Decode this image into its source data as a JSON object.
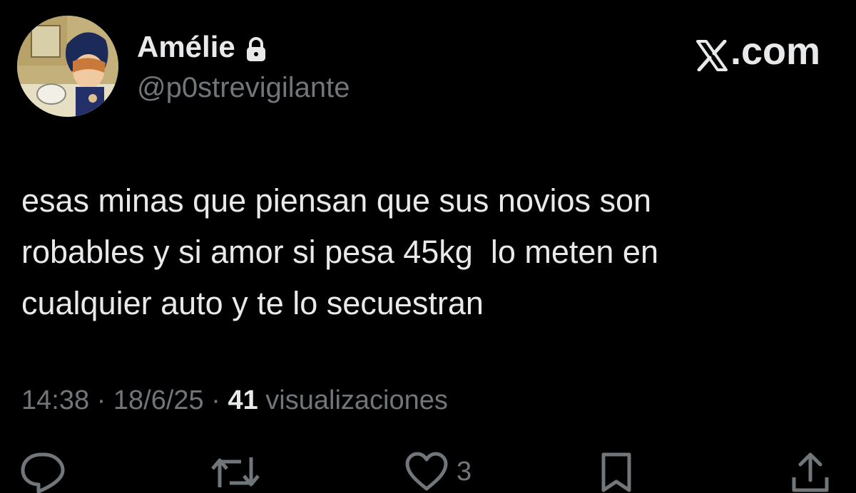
{
  "header": {
    "display_name": "Amélie",
    "handle": "@p0strevigilante",
    "brand": ".com",
    "brand_icon": "x-logo-icon",
    "lock_icon": "lock-icon"
  },
  "tweet": {
    "lines": [
      "esas minas que piensan que sus novios son",
      "robables y si amor si pesa 45kg  lo meten en",
      "cualquier auto y te lo secuestran"
    ],
    "time": "14:38",
    "date": "18/6/25",
    "separator": " · ",
    "views_count": "41",
    "views_label": " visualizaciones"
  },
  "actions": {
    "reply_icon": "reply-icon",
    "retweet_icon": "retweet-icon",
    "like_icon": "heart-icon",
    "like_count": "3",
    "bookmark_icon": "bookmark-icon",
    "share_icon": "share-icon"
  },
  "colors": {
    "background": "#000000",
    "primary_text": "#e7e9ea",
    "secondary_text": "#71767b"
  }
}
